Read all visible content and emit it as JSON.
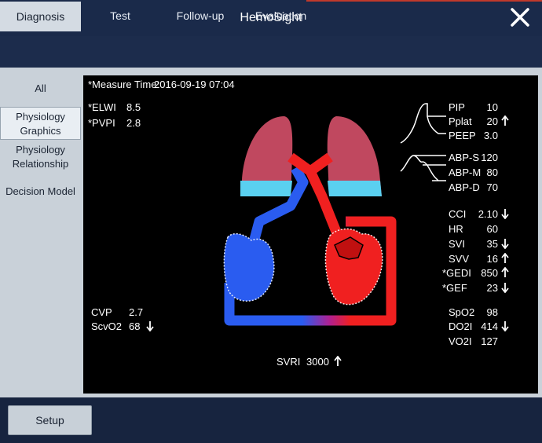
{
  "app": {
    "title": "HemoSight"
  },
  "tabs": [
    "Diagnosis",
    "Test",
    "Follow-up",
    "Evaluation"
  ],
  "sidebar": [
    {
      "label": "All"
    },
    {
      "label": "Physiology Graphics"
    },
    {
      "label": "Physiology Relationship"
    },
    {
      "label": "Decision Model"
    }
  ],
  "measure": {
    "label": "*Measure Time:",
    "value": "2016-09-19 07:04"
  },
  "lung_params": [
    {
      "label": "*ELWI",
      "value": "8.5"
    },
    {
      "label": "*PVPI",
      "value": "2.8"
    }
  ],
  "venous_params": [
    {
      "label": "CVP",
      "value": "2.7",
      "trend": ""
    },
    {
      "label": "ScvO2",
      "value": "68",
      "trend": "down"
    }
  ],
  "vent_params": [
    {
      "label": "PIP",
      "value": "10",
      "trend": ""
    },
    {
      "label": "Pplat",
      "value": "20",
      "trend": "up"
    },
    {
      "label": "PEEP",
      "value": "3.0",
      "trend": ""
    }
  ],
  "abp_params": [
    {
      "label": "ABP-S",
      "value": "120"
    },
    {
      "label": "ABP-M",
      "value": "80"
    },
    {
      "label": "ABP-D",
      "value": "70"
    }
  ],
  "cardiac_params": [
    {
      "label": "CCI",
      "value": "2.10",
      "trend": "down"
    },
    {
      "label": "HR",
      "value": "60",
      "trend": ""
    },
    {
      "label": "SVI",
      "value": "35",
      "trend": "down"
    },
    {
      "label": "SVV",
      "value": "16",
      "trend": "up"
    },
    {
      "label": "*GEDI",
      "value": "850",
      "trend": "up"
    },
    {
      "label": "*GEF",
      "value": "23",
      "trend": "down"
    }
  ],
  "oxygen_params": [
    {
      "label": "SpO2",
      "value": "98",
      "trend": ""
    },
    {
      "label": "DO2I",
      "value": "414",
      "trend": "down"
    },
    {
      "label": "VO2I",
      "value": "127",
      "trend": ""
    }
  ],
  "svri": {
    "label": "SVRI",
    "value": "3000",
    "trend": "up"
  },
  "setup_label": "Setup",
  "icons": {
    "close": "close-icon"
  },
  "colors": {
    "lung": "#c0485f",
    "lung_base": "#5ad0f0",
    "venous": "#2a5cf0",
    "arterial": "#f02020"
  }
}
